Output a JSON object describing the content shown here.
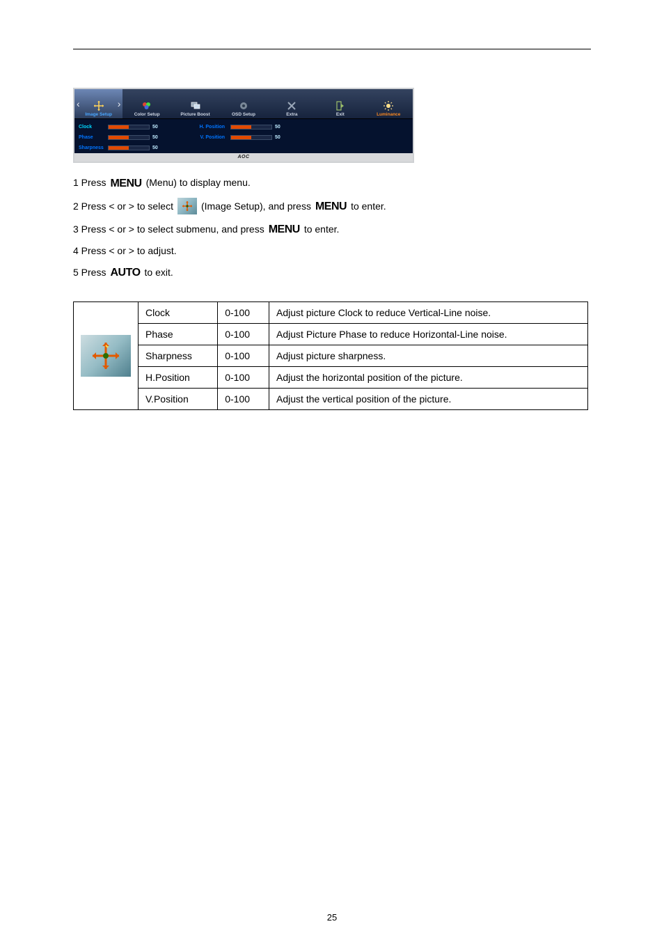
{
  "osd": {
    "tabs": [
      {
        "label": "Image Setup",
        "active": true
      },
      {
        "label": "Color Setup",
        "active": false
      },
      {
        "label": "Picture Boost",
        "active": false
      },
      {
        "label": "OSD Setup",
        "active": false
      },
      {
        "label": "Extra",
        "active": false
      },
      {
        "label": "Exit",
        "active": false
      },
      {
        "label": "Luminance",
        "active": false
      }
    ],
    "left_items": [
      {
        "label": "Clock",
        "value": "50",
        "fill": 50,
        "active": true
      },
      {
        "label": "Phase",
        "value": "50",
        "fill": 50,
        "active": false
      },
      {
        "label": "Sharpness",
        "value": "50",
        "fill": 50,
        "active": false
      }
    ],
    "right_items": [
      {
        "label": "H. Position",
        "value": "50",
        "fill": 50
      },
      {
        "label": "V. Position",
        "value": "50",
        "fill": 50
      }
    ],
    "footer": "AOC"
  },
  "instructions": {
    "line1_a": "1 Press ",
    "menu": "MENU",
    "line1_b": " (Menu) to display menu.",
    "line2_a": "2 Press < or > to select ",
    "line2_b": " (Image Setup), and press ",
    "line2_c": " to enter.",
    "line3_a": "3 Press < or > to select submenu, and press ",
    "line3_b": " to enter.",
    "line4": "4 Press < or > to adjust.",
    "line5_a": "5 Press ",
    "auto": "AUTO",
    "line5_b": " to exit."
  },
  "table": {
    "rows": [
      {
        "name": "Clock",
        "range": "0-100",
        "desc": "Adjust picture Clock to reduce Vertical-Line noise."
      },
      {
        "name": "Phase",
        "range": "0-100",
        "desc": "Adjust Picture Phase to reduce Horizontal-Line noise."
      },
      {
        "name": "Sharpness",
        "range": "0-100",
        "desc": "Adjust picture sharpness."
      },
      {
        "name": "H.Position",
        "range": "0-100",
        "desc": "Adjust the horizontal position of the picture."
      },
      {
        "name": "V.Position",
        "range": "0-100",
        "desc": "Adjust the vertical position of the picture."
      }
    ]
  },
  "page_number": "25"
}
